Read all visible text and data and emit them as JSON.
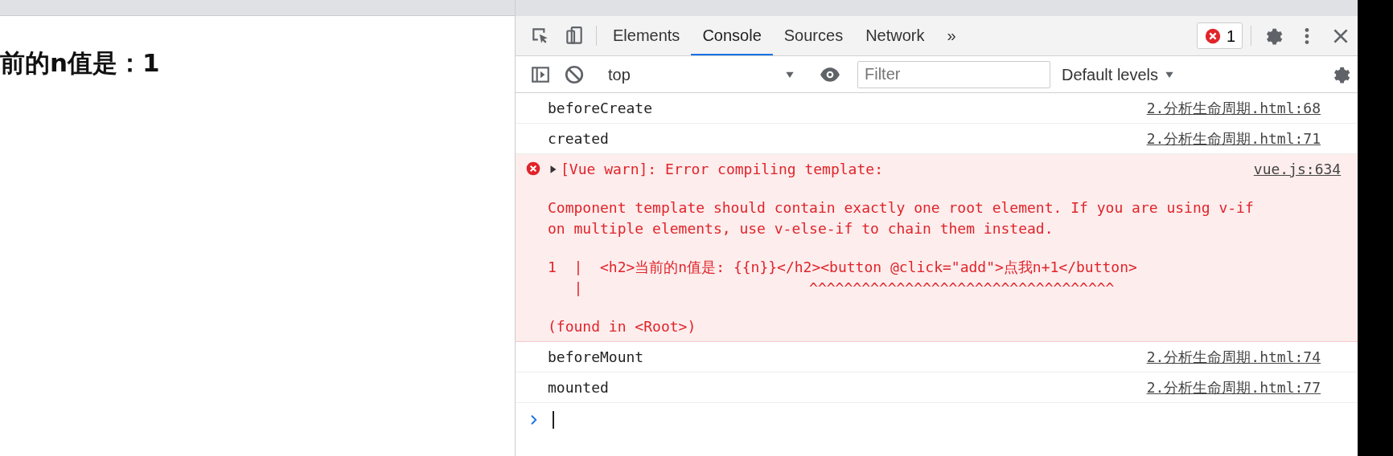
{
  "page": {
    "heading": "前的n值是：1"
  },
  "devtools": {
    "tabs": [
      {
        "label": "Elements",
        "selected": false
      },
      {
        "label": "Console",
        "selected": true
      },
      {
        "label": "Sources",
        "selected": false
      },
      {
        "label": "Network",
        "selected": false
      }
    ],
    "more_tabs": "»",
    "error_count": "1",
    "console_toolbar": {
      "context": "top",
      "filter_placeholder": "Filter",
      "levels": "Default levels"
    },
    "messages": [
      {
        "kind": "log",
        "text": "beforeCreate",
        "source": "2.分析生命周期.html:68"
      },
      {
        "kind": "log",
        "text": "created",
        "source": "2.分析生命周期.html:71"
      },
      {
        "kind": "error",
        "expanded": false,
        "text": "[Vue warn]: Error compiling template:",
        "source": "vue.js:634",
        "details": [
          "Component template should contain exactly one root element. If you are using v-if\non multiple elements, use v-else-if to chain them instead.",
          "1  |  <h2>当前的n值是: {{n}}</h2><button @click=\"add\">点我n+1</button>\n   |                          ^^^^^^^^^^^^^^^^^^^^^^^^^^^^^^^^^^^",
          "(found in <Root>)"
        ]
      },
      {
        "kind": "log",
        "text": "beforeMount",
        "source": "2.分析生命周期.html:74"
      },
      {
        "kind": "log",
        "text": "mounted",
        "source": "2.分析生命周期.html:77"
      }
    ]
  }
}
